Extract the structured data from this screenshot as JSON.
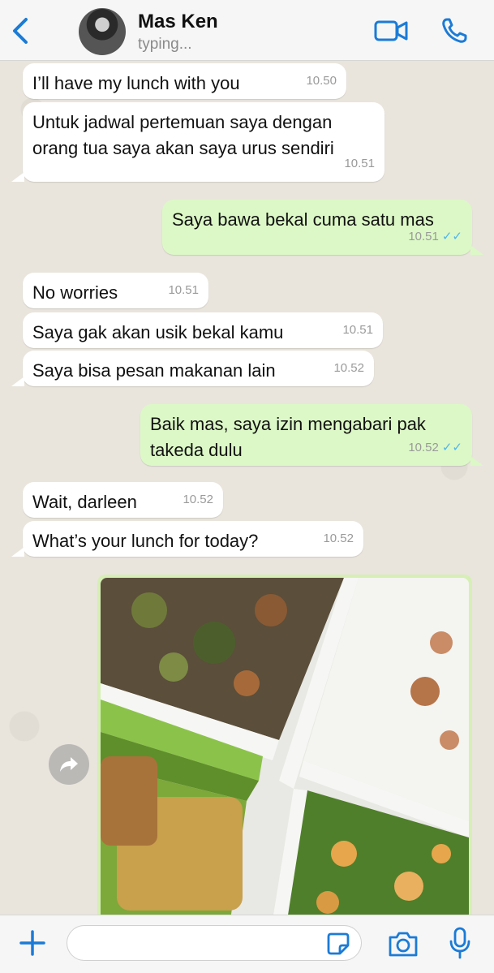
{
  "header": {
    "contact_name": "Mas Ken",
    "status": "typing...",
    "accent_color": "#1b7bd6"
  },
  "messages": [
    {
      "direction": "in",
      "text": "I’ll have my lunch with you",
      "time": "10.50"
    },
    {
      "direction": "in",
      "text": "Untuk jadwal pertemuan saya dengan orang tua saya akan saya urus sendiri",
      "time": "10.51"
    },
    {
      "direction": "out",
      "text": "Saya bawa bekal cuma satu mas",
      "time": "10.51",
      "read": true
    },
    {
      "direction": "in",
      "text": "No worries",
      "time": "10.51"
    },
    {
      "direction": "in",
      "text": "Saya gak akan usik bekal kamu",
      "time": "10.51"
    },
    {
      "direction": "in",
      "text": "Saya bisa pesan makanan lain",
      "time": "10.52"
    },
    {
      "direction": "out",
      "text": "Baik mas, saya izin mengabari pak takeda dulu",
      "time": "10.52",
      "read": true
    },
    {
      "direction": "in",
      "text": "Wait, darleen",
      "time": "10.52"
    },
    {
      "direction": "in",
      "text": "What’s your lunch for today?",
      "time": "10.52"
    }
  ],
  "photo_message": {
    "direction": "out",
    "content": "bento-lunch-photo"
  },
  "icons": {
    "back": "chevron-left-icon",
    "video": "video-camera-icon",
    "call": "phone-icon",
    "forward": "forward-arrow-icon",
    "plus": "plus-icon",
    "sticker": "sticker-icon",
    "camera": "camera-icon",
    "mic": "microphone-icon"
  },
  "composer": {
    "placeholder": ""
  },
  "colors": {
    "incoming_bubble": "#ffffff",
    "outgoing_bubble": "#dcf8c6",
    "read_ticks": "#4fb6ec",
    "chat_background": "#e9e5dd"
  }
}
